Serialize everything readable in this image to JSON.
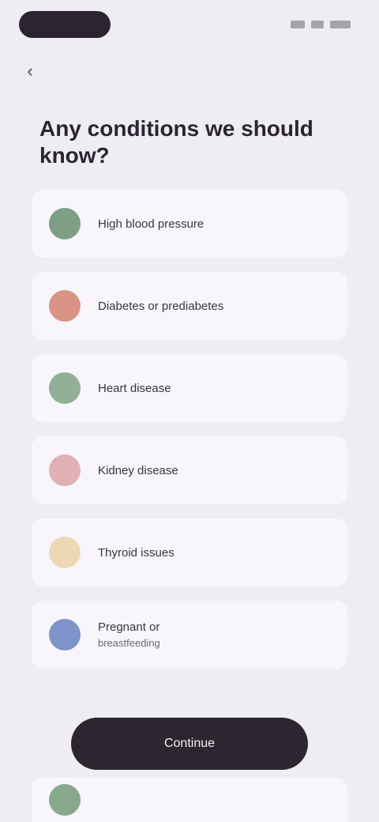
{
  "status_bar": {
    "icons": [
      "signal-icon",
      "wifi-icon",
      "battery-icon"
    ]
  },
  "header": {
    "title": "Any conditions we should know?"
  },
  "conditions": [
    {
      "label": "High blood pressure",
      "sub": "",
      "color": "#7f9e86",
      "icon": "heart-icon"
    },
    {
      "label": "Diabetes or prediabetes",
      "sub": "",
      "color": "#d99385",
      "icon": "drop-icon"
    },
    {
      "label": "Heart disease",
      "sub": "",
      "color": "#92b097",
      "icon": "pulse-icon"
    },
    {
      "label": "Kidney disease",
      "sub": "",
      "color": "#e0b0b4",
      "icon": "kidney-icon"
    },
    {
      "label": "Thyroid issues",
      "sub": "",
      "color": "#edd8b4",
      "icon": "thyroid-icon"
    },
    {
      "label": "Pregnant or",
      "sub": "breastfeeding",
      "color": "#7d93c9",
      "icon": "baby-icon"
    }
  ],
  "cta": {
    "label": "Continue"
  },
  "partial_item": {
    "color": "#88a88c",
    "icon": "leaf-icon"
  }
}
